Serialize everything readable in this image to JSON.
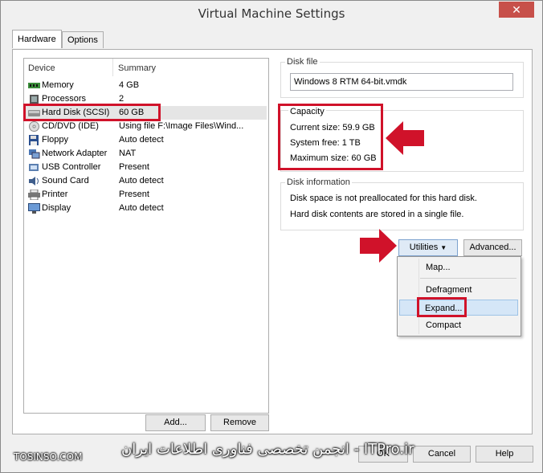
{
  "window": {
    "title": "Virtual Machine Settings",
    "close_glyph": "✕"
  },
  "tabs": [
    {
      "label": "Hardware"
    },
    {
      "label": "Options"
    }
  ],
  "device_list": {
    "col_device": "Device",
    "col_summary": "Summary",
    "rows": [
      {
        "device": "Memory",
        "summary": "4 GB",
        "icon": "memory-icon"
      },
      {
        "device": "Processors",
        "summary": "2",
        "icon": "processor-icon"
      },
      {
        "device": "Hard Disk (SCSI)",
        "summary": "60 GB",
        "icon": "hard-disk-icon"
      },
      {
        "device": "CD/DVD (IDE)",
        "summary": "Using file F:\\Image Files\\Wind...",
        "icon": "cd-dvd-icon"
      },
      {
        "device": "Floppy",
        "summary": "Auto detect",
        "icon": "floppy-icon"
      },
      {
        "device": "Network Adapter",
        "summary": "NAT",
        "icon": "network-adapter-icon"
      },
      {
        "device": "USB Controller",
        "summary": "Present",
        "icon": "usb-icon"
      },
      {
        "device": "Sound Card",
        "summary": "Auto detect",
        "icon": "sound-card-icon"
      },
      {
        "device": "Printer",
        "summary": "Present",
        "icon": "printer-icon"
      },
      {
        "device": "Display",
        "summary": "Auto detect",
        "icon": "display-icon"
      }
    ],
    "add_label": "Add...",
    "remove_label": "Remove"
  },
  "disk_file": {
    "label": "Disk file",
    "value": "Windows 8 RTM 64-bit.vmdk"
  },
  "capacity": {
    "label": "Capacity",
    "current": "Current size:  59.9 GB",
    "free": "System free:  1 TB",
    "max": "Maximum size:  60 GB"
  },
  "disk_info": {
    "label": "Disk information",
    "line1": "Disk space is not preallocated for this hard disk.",
    "line2": "Hard disk contents are stored in a single file."
  },
  "utilities": {
    "label": "Utilities",
    "advanced_label": "Advanced..."
  },
  "menu": {
    "items": [
      "Map...",
      "Defragment",
      "Expand...",
      "Compact"
    ]
  },
  "footer": {
    "ok_label": "OK",
    "cancel_label": "Cancel",
    "help_label": "Help",
    "watermark_left": "TOSINSO.COM",
    "watermark_right": "ITPro.ir - انجمن تخصصی فناوری اطلاعات ایران"
  },
  "colors": {
    "highlight_red": "#d0122a",
    "menu_highlight": "#d5e6f7"
  }
}
